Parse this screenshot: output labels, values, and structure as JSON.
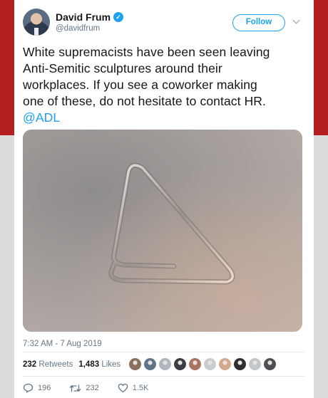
{
  "author": {
    "name": "David Frum",
    "handle": "@davidfrum",
    "verified": true,
    "avatar_icon": "avatar-photo"
  },
  "follow_label": "Follow",
  "tweet": {
    "lines": [
      "White supremacists have been seen leaving",
      "Anti-Semitic sculptures around their",
      "workplaces.  If you see a coworker making",
      "one of these, do not hesitate to contact HR."
    ],
    "mention": "@ADL"
  },
  "media": {
    "icon": "paperclip-photo"
  },
  "timestamp": "7:32 AM - 7 Aug 2019",
  "stats": {
    "retweets_count": "232",
    "retweets_label": "Retweets",
    "likes_count": "1,483",
    "likes_label": "Likes"
  },
  "likers": {
    "colors": [
      "#8a6f5c",
      "#5f7389",
      "#b0b6bd",
      "#3b3f45",
      "#a9745e",
      "#c9ccd0",
      "#d3a98d",
      "#2e2e33",
      "#c2c6cb",
      "#4d4f52"
    ]
  },
  "actions": {
    "replies": "196",
    "retweets": "232",
    "likes": "1.5K"
  },
  "colors": {
    "accent": "#1da1f2",
    "text": "#14171a",
    "muted": "#657786",
    "background_red": "#b11e1e"
  }
}
